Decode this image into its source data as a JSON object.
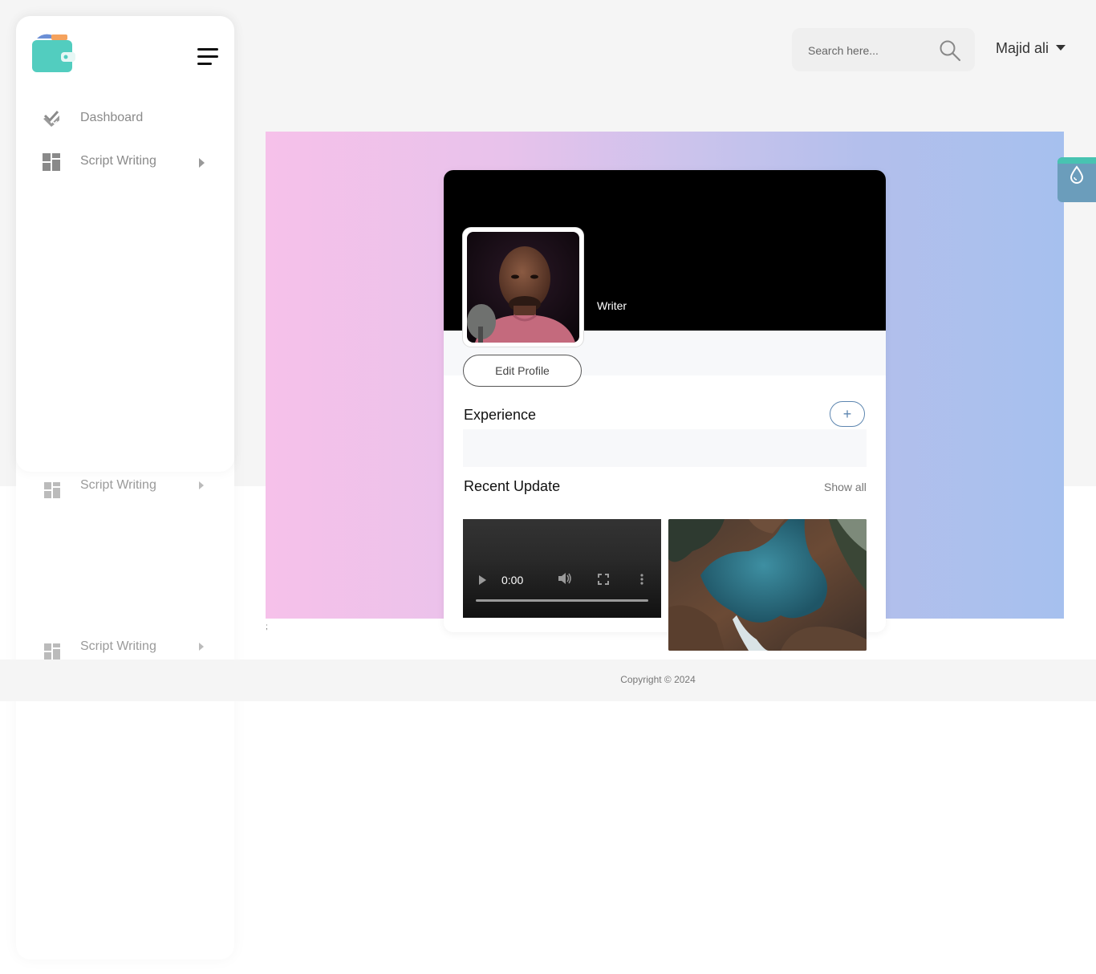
{
  "sidebar": {
    "logo_icon": "wallet-icon",
    "menu_icon": "hamburger-menu-icon",
    "items": [
      {
        "label": "Dashboard",
        "icon": "dashboard-check-icon"
      },
      {
        "label": "Script Writing",
        "icon": "grid-layout-icon",
        "has_submenu": true
      }
    ],
    "ghost_items": [
      {
        "label": "Script Writing"
      },
      {
        "label": "Script Writing"
      }
    ]
  },
  "header": {
    "search": {
      "placeholder": "Search here...",
      "value": "",
      "icon": "search-icon"
    },
    "user": {
      "name": "Majid ali",
      "icon": "caret-down-icon"
    }
  },
  "profile": {
    "role": "Writer",
    "edit_button": "Edit Profile",
    "experience_title": "Experience",
    "add_button": "+",
    "recent_title": "Recent Update",
    "show_all": "Show all",
    "video": {
      "time": "0:00",
      "progress": 0
    }
  },
  "stray_mark": ";",
  "footer": {
    "copyright": "Copyright © 2024"
  },
  "colors": {
    "accent_teal": "#48c3b1",
    "accent_blue": "#5d86b0",
    "gradient_start": "#f6c1ea",
    "gradient_end": "#a6c0ee"
  }
}
